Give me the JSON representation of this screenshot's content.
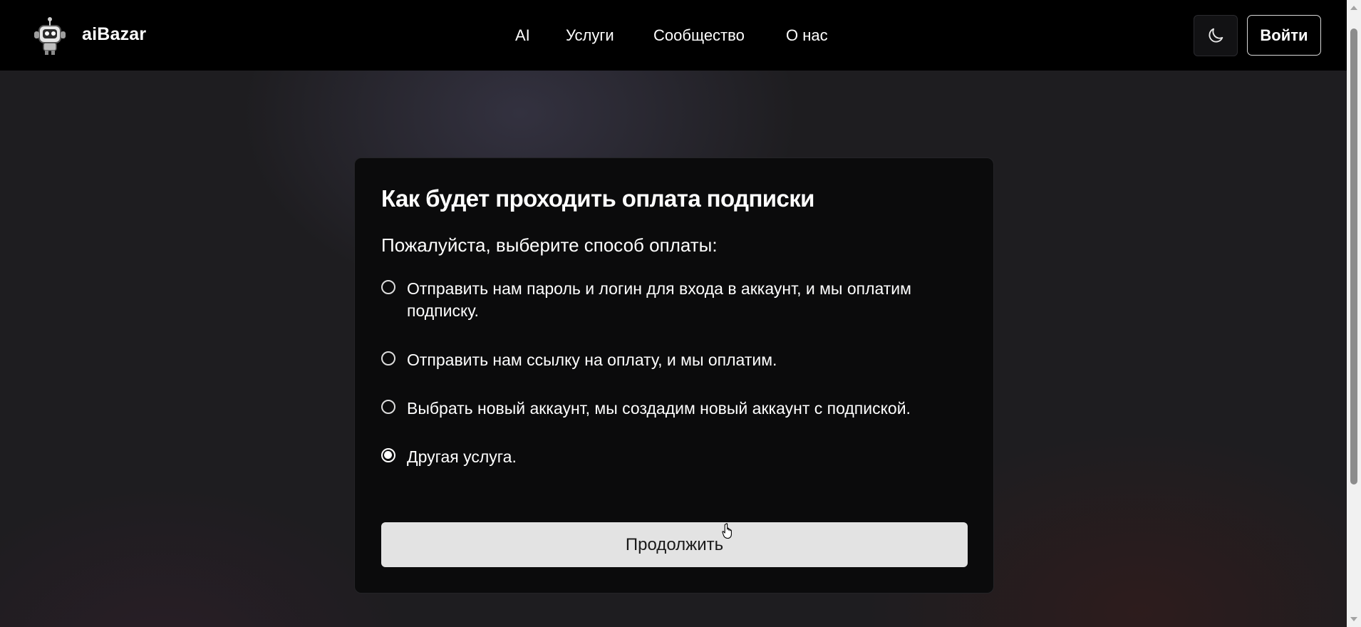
{
  "header": {
    "brand": "aiBazar",
    "logo_icon": "robot-icon",
    "nav": [
      "AI",
      "Услуги",
      "Сообщество",
      "О нас"
    ],
    "theme_icon": "moon-icon",
    "login_label": "Войти"
  },
  "card": {
    "title": "Как будет проходить оплата подписки",
    "subtitle": "Пожалуйста, выберите способ оплаты:",
    "options": [
      {
        "label": "Отправить нам пароль и логин для входа в аккаунт, и мы оплатим подписку.",
        "checked": false
      },
      {
        "label": "Отправить нам ссылку на оплату, и мы оплатим.",
        "checked": false
      },
      {
        "label": "Выбрать новый аккаунт, мы создадим новый аккаунт с подпиской.",
        "checked": false
      },
      {
        "label": "Другая услуга.",
        "checked": true
      }
    ],
    "continue_label": "Продолжить"
  },
  "colors": {
    "header_bg": "#000000",
    "card_bg": "#0b0b0c",
    "button_bg": "#e3e3e3",
    "text": "#ffffff"
  }
}
